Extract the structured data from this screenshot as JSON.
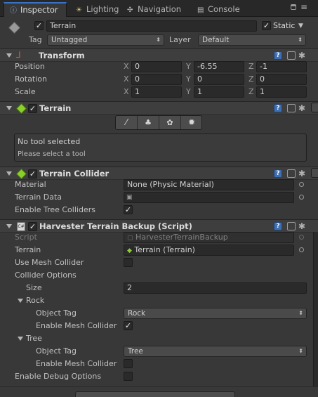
{
  "tabs": [
    {
      "label": "Inspector",
      "icon": "info-icon",
      "active": true
    },
    {
      "label": "Lighting",
      "icon": "bulb-icon",
      "active": false
    },
    {
      "label": "Navigation",
      "icon": "navigation-icon",
      "active": false
    },
    {
      "label": "Console",
      "icon": "console-icon",
      "active": false
    }
  ],
  "object": {
    "name": "Terrain",
    "active": true,
    "static_label": "Static",
    "static_checked": true,
    "tag_label": "Tag",
    "tag_value": "Untagged",
    "layer_label": "Layer",
    "layer_value": "Default"
  },
  "transform": {
    "title": "Transform",
    "rows": [
      {
        "label": "Position",
        "x": "0",
        "y": "-6.55",
        "z": "-1"
      },
      {
        "label": "Rotation",
        "x": "0",
        "y": "0",
        "z": "0"
      },
      {
        "label": "Scale",
        "x": "1",
        "y": "1",
        "z": "1"
      }
    ],
    "axis_x": "X",
    "axis_y": "Y",
    "axis_z": "Z"
  },
  "terrain": {
    "title": "Terrain",
    "status": "No tool selected",
    "hint": "Please select a tool"
  },
  "collider": {
    "title": "Terrain Collider",
    "material_label": "Material",
    "material_value": "None (Physic Material)",
    "data_label": "Terrain Data",
    "data_value": "",
    "trees_label": "Enable Tree Colliders",
    "trees_checked": true
  },
  "harvester": {
    "title": "Harvester Terrain Backup (Script)",
    "script_label": "Script",
    "script_value": "HarvesterTerrainBackup",
    "terrain_label": "Terrain",
    "terrain_value": "Terrain (Terrain)",
    "mesh_label": "Use Mesh Collider",
    "options_label": "Collider Options",
    "size_label": "Size",
    "size_value": "2",
    "rock_label": "Rock",
    "rock_tag_label": "Object Tag",
    "rock_tag_value": "Rock",
    "rock_mesh_label": "Enable Mesh Collider",
    "tree_label": "Tree",
    "tree_tag_label": "Object Tag",
    "tree_tag_value": "Tree",
    "tree_mesh_label": "Enable Mesh Collider",
    "debug_label": "Enable Debug Options"
  },
  "colors": {
    "panel": "#383838",
    "header": "#3e3e3e",
    "accent": "#3a72c4",
    "field": "#2a2a2a"
  }
}
